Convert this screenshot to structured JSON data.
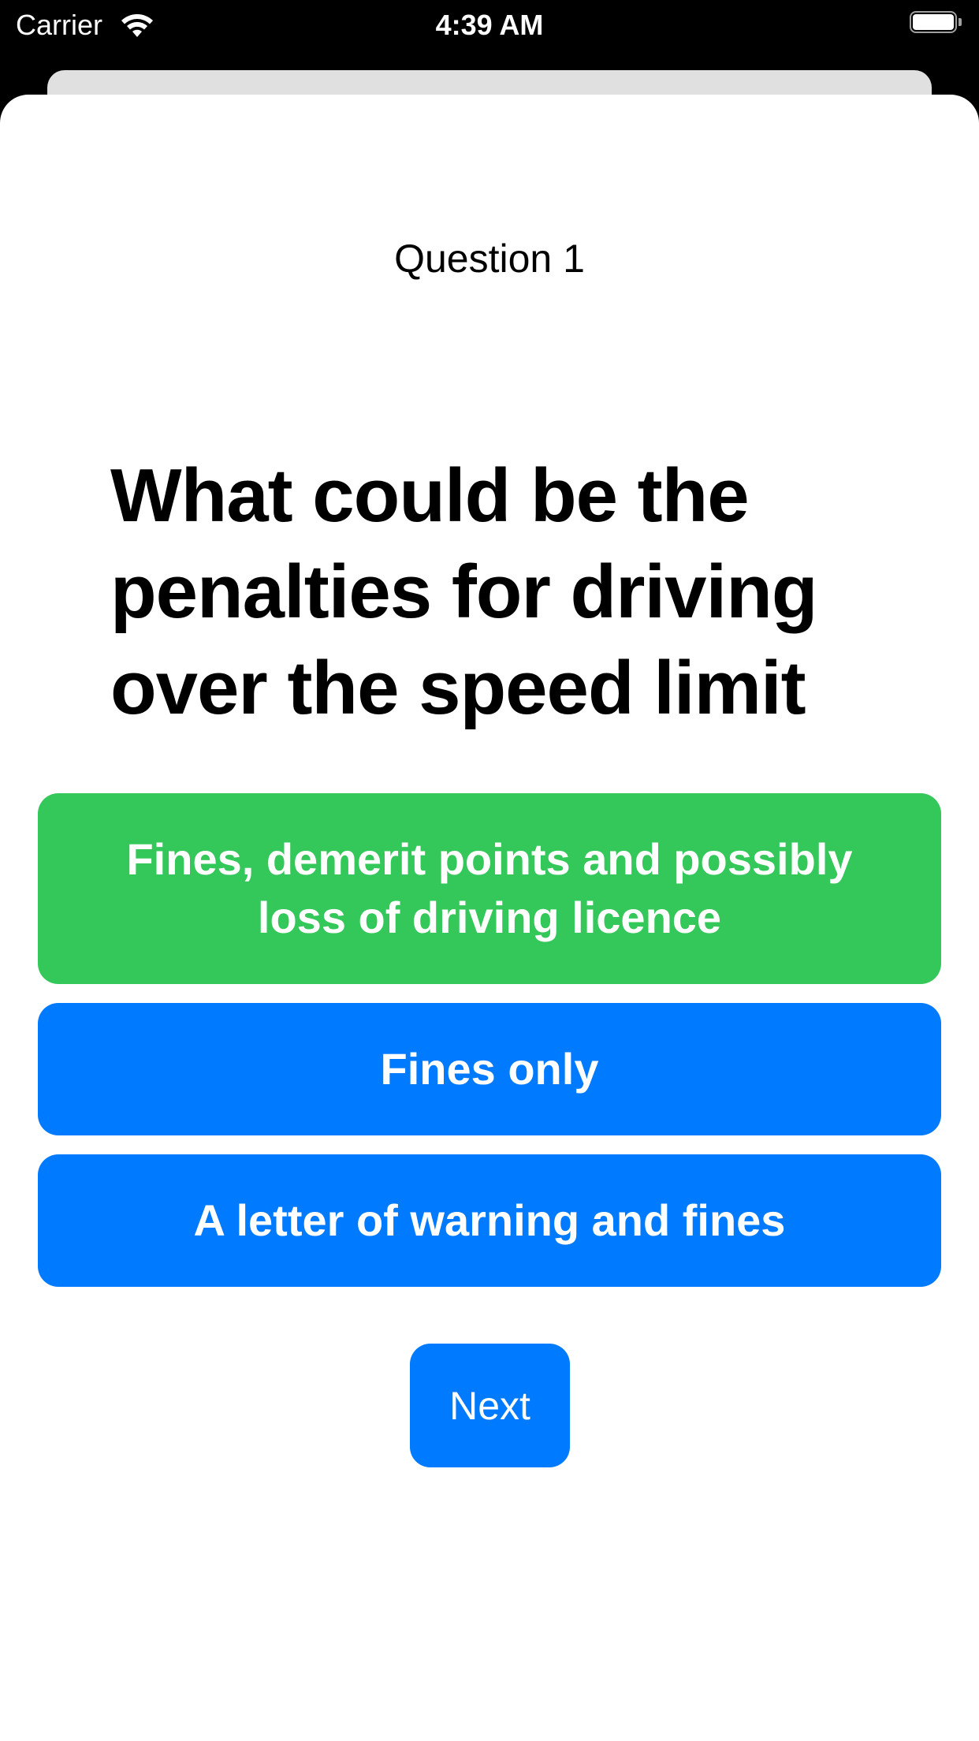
{
  "status_bar": {
    "carrier": "Carrier",
    "time": "4:39 AM",
    "wifi_icon": "wifi-icon",
    "battery_icon": "battery-icon"
  },
  "quiz": {
    "question_number": "Question 1",
    "question_text": "What could be the penalties for driving over the speed limit",
    "answers": [
      {
        "label": "Fines, demerit points and possibly loss of driving licence",
        "color": "#34c759",
        "state": "correct"
      },
      {
        "label": "Fines only",
        "color": "#007aff"
      },
      {
        "label": "A letter of warning and fines",
        "color": "#007aff"
      }
    ],
    "next_label": "Next"
  },
  "colors": {
    "accent": "#007aff",
    "correct": "#34c759",
    "status_bar_bg": "#000000",
    "sheet_bg": "#ffffff"
  }
}
